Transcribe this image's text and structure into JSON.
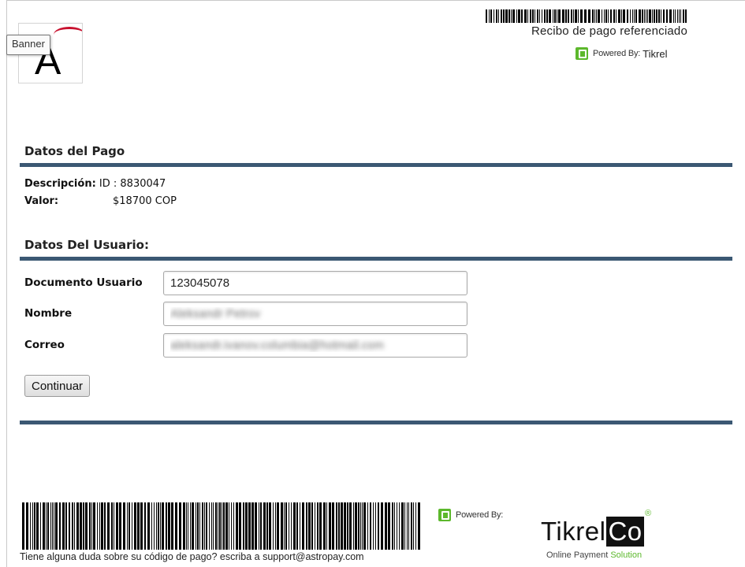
{
  "header": {
    "logo_letter": "A",
    "tooltip": "Banner",
    "receipt_title": "Recibo de pago referenciado",
    "powered_prefix": "Powered By:",
    "powered_brand": "Tikrel"
  },
  "payment": {
    "title": "Datos del Pago",
    "description_label": "Descripción:",
    "description_value": "ID : 8830047",
    "value_label": "Valor:",
    "value_value": "$18700 COP"
  },
  "user": {
    "title": "Datos Del Usuario:",
    "document_label": "Documento Usuario",
    "document_value": "123045078",
    "name_label": "Nombre",
    "name_value": "Aleksandr Petrov",
    "email_label": "Correo",
    "email_value": "aleksandr.ivanov.columbia@hotmail.com"
  },
  "actions": {
    "continue_label": "Continuar"
  },
  "footer": {
    "help_text": "Tiene alguna duda sobre su código de pago? escriba a support@astropay.com",
    "powered_prefix": "Powered By:",
    "logo_word": "Tikrel",
    "logo_co": "Co",
    "logo_registered": "®",
    "logo_tagline_a": "Online Payment",
    "logo_tagline_b": "Solution"
  },
  "colors": {
    "rule": "#3b5873",
    "brand_green": "#5cb82c",
    "logo_red": "#c8102e"
  },
  "icons": [
    "tikrel-green-icon"
  ]
}
